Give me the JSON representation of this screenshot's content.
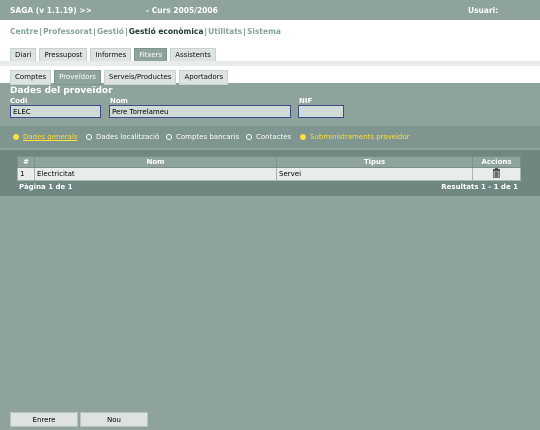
{
  "header": {
    "app_version": "SAGA (v 1.1.19) >>",
    "course": "- Curs 2005/2006",
    "user_label": "Usuari:"
  },
  "nav": {
    "items": [
      "Centre",
      "Professorat",
      "Gestió",
      "Gestió econòmica",
      "Utilitats",
      "Sistema"
    ],
    "active": "Gestió econòmica",
    "separator": "|"
  },
  "tabs_level1": [
    "Diari",
    "Pressupost",
    "Informes",
    "Fitxers",
    "Assistents"
  ],
  "tabs_level1_active": "Fitxers",
  "tabs_level2": [
    "Comptes",
    "Proveïdors",
    "Serveis/Productes",
    "Aportadors"
  ],
  "tabs_level2_active": "Proveïdors",
  "form": {
    "title": "Dades del proveïdor",
    "codi_label": "Codi",
    "codi_value": "ELEC",
    "nom_label": "Nom",
    "nom_value": "Pere Torrelameu",
    "nif_label": "NIF",
    "nif_value": ""
  },
  "subtabs": [
    {
      "label": "Dades generals",
      "selected": true
    },
    {
      "label": "Dades localització",
      "selected": false
    },
    {
      "label": "Comptes bancaris",
      "selected": false
    },
    {
      "label": "Contactes",
      "selected": false
    },
    {
      "label": "Subministraments proveïdor",
      "selected": true
    }
  ],
  "table": {
    "columns": [
      "#",
      "Nom",
      "Tipus",
      "Accions"
    ],
    "rows": [
      {
        "num": "1",
        "nom": "Electricitat",
        "tipus": "Servei",
        "action_icon": "trash-icon"
      }
    ]
  },
  "pagination": {
    "page_text": "Pàgina 1 de 1",
    "results_text": "Resultats 1 - 1 de 1"
  },
  "buttons": {
    "back": "Enrere",
    "new": "Nou"
  },
  "colors": {
    "panel": "#8fa39d",
    "highlight": "#ffdf3a",
    "field_border": "#3a4c8c"
  }
}
